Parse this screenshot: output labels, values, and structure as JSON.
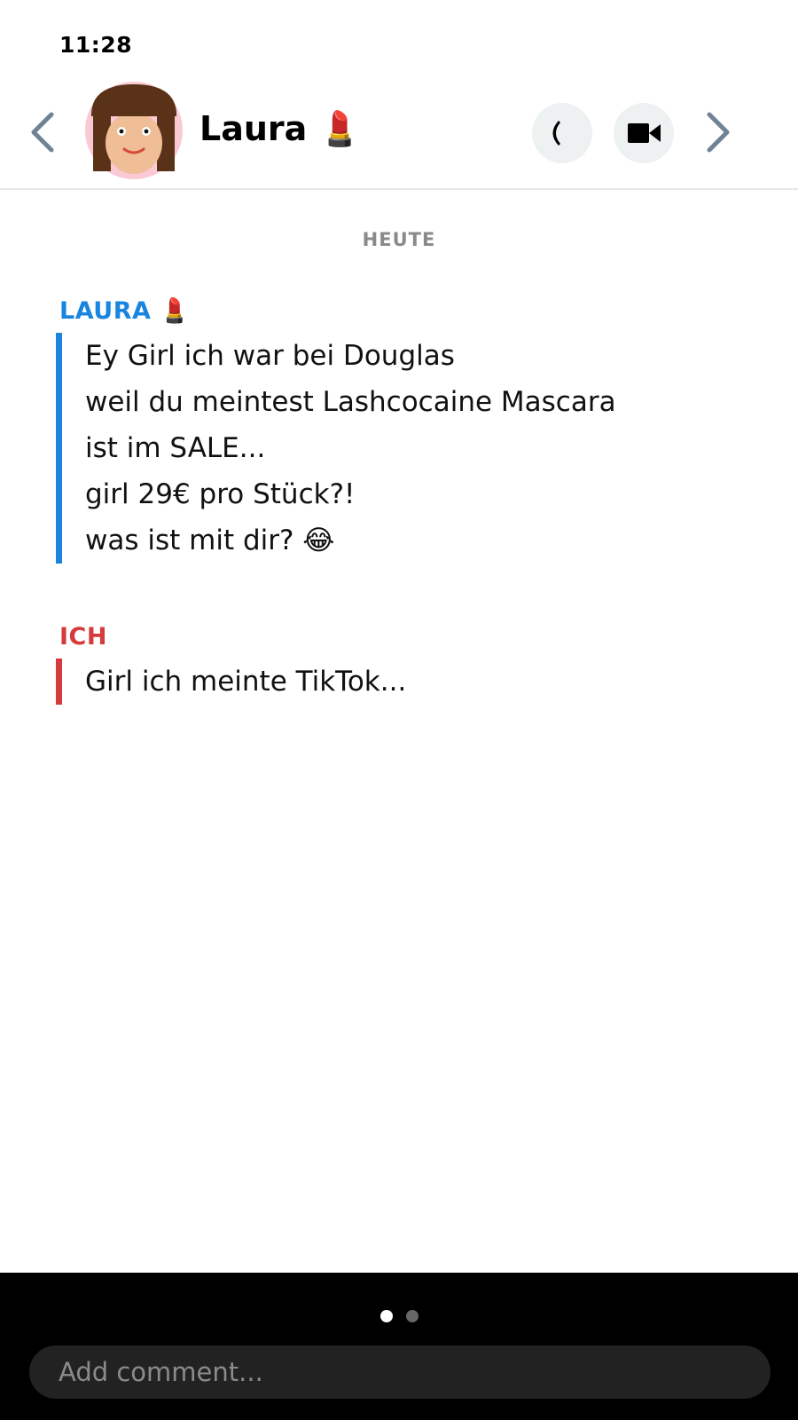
{
  "status_bar": {
    "time": "11:28"
  },
  "header": {
    "contact_name": "Laura 💄",
    "icons": {
      "back": "chevron-left-icon",
      "forward": "chevron-right-icon",
      "call": "phone-icon",
      "video": "video-camera-icon"
    },
    "colors": {
      "chevron": "#6f8296",
      "button_bg": "#eef1f1"
    }
  },
  "day_divider": "HEUTE",
  "messages": [
    {
      "sender": "LAURA 💄",
      "color": "#1a85e0",
      "lines": [
        "Ey Girl ich war bei Douglas",
        "weil du meintest Lashcocaine Mascara",
        "ist im SALE...",
        "girl 29€ pro Stück?!",
        "was ist mit dir? 😂"
      ]
    },
    {
      "sender": "ICH",
      "color": "#d63a3a",
      "lines": [
        "Girl ich meinte TikTok..."
      ]
    }
  ],
  "bottom": {
    "page_indicator": {
      "current": 1,
      "total": 2
    },
    "comment_placeholder": "Add comment..."
  }
}
